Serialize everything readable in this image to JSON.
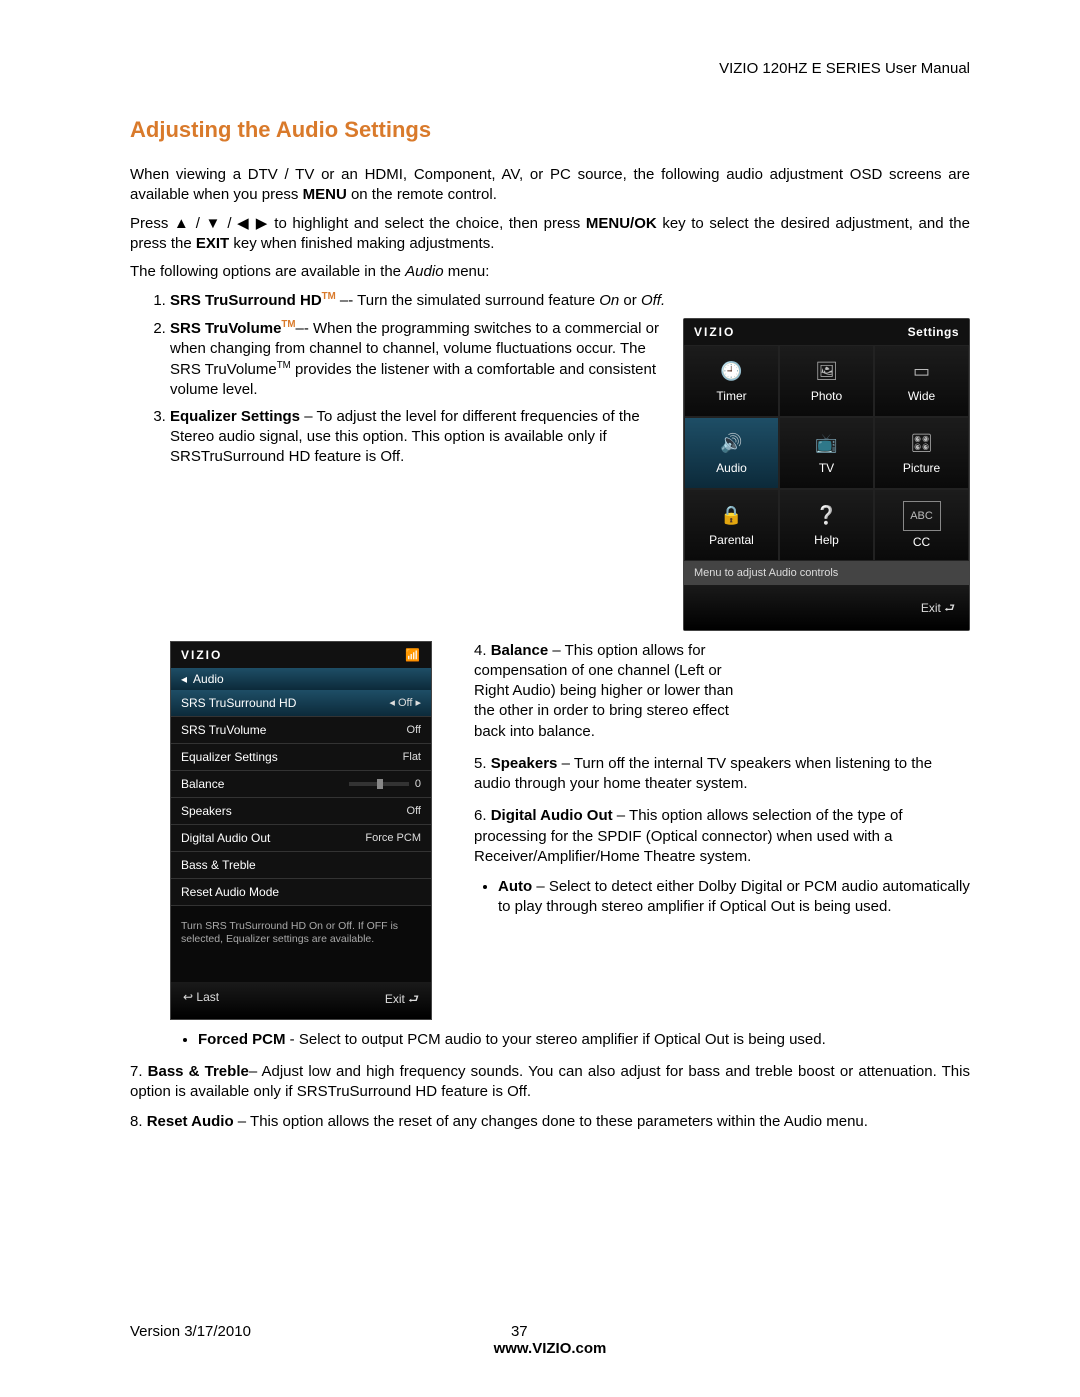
{
  "header": {
    "product_line": "VIZIO 120HZ E SERIES User Manual"
  },
  "title": "Adjusting the Audio Settings",
  "para1a": "When viewing a DTV / TV or an HDMI, Component, AV, or PC source, the following audio adjustment OSD screens are available when you press ",
  "para1_bold": "MENU",
  "para1b": " on the remote control.",
  "para2a": "Press ▲ / ▼ / ◀  ▶ to highlight and select the choice, then press ",
  "para2_bold1": "MENU/OK",
  "para2b": " key to select the desired adjustment, and the press the ",
  "para2_bold2": "EXIT",
  "para2c": " key when finished making adjustments.",
  "para3a": "The following options are available in the ",
  "para3_it": "Audio",
  "para3b": " menu:",
  "item1_label": "SRS TruSurround HD",
  "item1_tm": "TM",
  "item1_dash": " –- ",
  "item1_text_a": "Turn the simulated surround feature ",
  "item1_on": "On",
  "item1_or": " or ",
  "item1_off": "Off.",
  "item2_label": "SRS TruVolume",
  "item2_tm": "TM",
  "item2_dash": "–- ",
  "item2_text": "When the programming switches to a commercial or when changing from channel to channel, volume fluctuations occur. The SRS TruVolume",
  "item2_tm2": "TM",
  "item2_text2": "  provides the listener with a comfortable and consistent volume level.",
  "item3_label": "Equalizer Settings",
  "item3_text": " – To adjust the level for different frequencies of the Stereo audio signal, use this option. This option is available only if SRSTruSurround HD feature is Off.",
  "item4_label": "Balance",
  "item4_text": " – This option allows for compensation of one channel (Left or Right Audio) being higher or lower than the other in order to bring stereo effect back into balance.",
  "item5_label": "Speakers",
  "item5_text": " – Turn off the internal TV speakers when listening to the audio through your home theater system.",
  "item6_label": "Digital Audio Out",
  "item6_text": " – This option allows selection of the type of processing for the SPDIF (Optical connector) when used with a Receiver/Amplifier/Home Theatre system.",
  "dao_auto_label": "Auto",
  "dao_auto_text": " – Select to detect either Dolby Digital or PCM audio automatically to play through stereo amplifier if Optical Out is being used.",
  "dao_fpcm_label": "Forced PCM",
  "dao_fpcm_text": " - Select to output PCM audio to your stereo amplifier if Optical Out is being used.",
  "item7_num": " 7. ",
  "item7_label": "Bass & Treble",
  "item7_text": "– Adjust low and high frequency sounds. You can also adjust for bass and treble boost or attenuation. ",
  "item7_text2": "This option is available only if SRSTruSurround HD feature is Off.",
  "item8_num": "8.  ",
  "item8_label": "Reset Audio",
  "item8_text": " – This option allows the reset of any changes done to these parameters within the Audio menu.",
  "settings_osd": {
    "brand": "VIZIO",
    "screen": "Settings",
    "cells": [
      "Timer",
      "Photo",
      "Wide",
      "Audio",
      "TV",
      "Picture",
      "Parental",
      "Help",
      "CC"
    ],
    "hint": "Menu to adjust Audio controls",
    "exit": "Exit"
  },
  "audio_osd": {
    "brand": "VIZIO",
    "crumb": "Audio",
    "items": [
      {
        "name": "SRS TruSurround HD",
        "value": "◂ Off ▸",
        "sel": true
      },
      {
        "name": "SRS TruVolume",
        "value": "Off"
      },
      {
        "name": "Equalizer Settings",
        "value": "Flat"
      },
      {
        "name": "Balance",
        "value": "0",
        "slider": true
      },
      {
        "name": "Speakers",
        "value": "Off"
      },
      {
        "name": "Digital Audio Out",
        "value": "Force PCM"
      },
      {
        "name": "Bass & Treble",
        "value": ""
      },
      {
        "name": "Reset Audio Mode",
        "value": ""
      }
    ],
    "hint": "Turn SRS TruSurround HD On or Off. If OFF is selected, Equalizer settings are available.",
    "last": "Last",
    "exit": "Exit"
  },
  "footer": {
    "version": "Version 3/17/2010",
    "page": "37",
    "url": "www.VIZIO.com"
  }
}
